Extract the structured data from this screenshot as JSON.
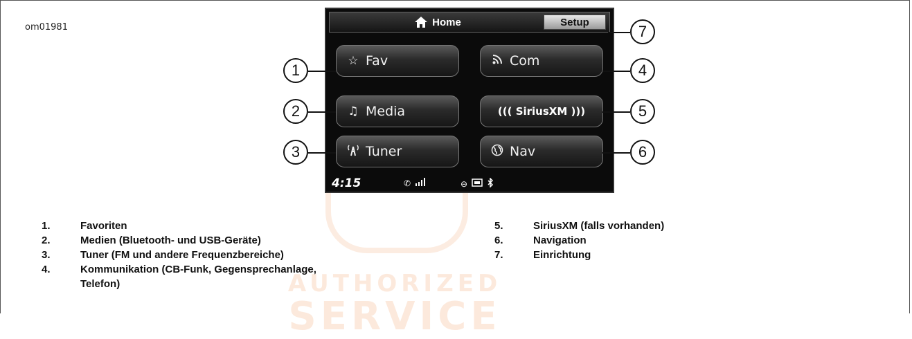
{
  "figure_id": "om01981",
  "watermark": {
    "line1": "AUTHORIZED",
    "line2": "SERVICE"
  },
  "screen": {
    "topbar": {
      "home_label": "Home",
      "setup_label": "Setup"
    },
    "buttons": [
      {
        "label": "Fav",
        "icon": "star-icon"
      },
      {
        "label": "Com",
        "icon": "rss-icon"
      },
      {
        "label": "Media",
        "icon": "music-note-icon"
      },
      {
        "label": "SiriusXM",
        "icon": "siriusxm-logo"
      },
      {
        "label": "Tuner",
        "icon": "antenna-icon"
      },
      {
        "label": "Nav",
        "icon": "globe-icon"
      }
    ],
    "status": {
      "time": "4:15"
    }
  },
  "callouts": [
    "1",
    "2",
    "3",
    "4",
    "5",
    "6",
    "7"
  ],
  "legend": {
    "left": [
      {
        "num": "1.",
        "text": "Favoriten"
      },
      {
        "num": "2.",
        "text": "Medien (Bluetooth- und USB-Geräte)"
      },
      {
        "num": "3.",
        "text": "Tuner (FM und andere Frequenzbereiche)"
      },
      {
        "num": "4.",
        "text": "Kommunikation (CB-Funk, Gegensprechanlage,"
      },
      {
        "num": "",
        "text": "Telefon)"
      }
    ],
    "right": [
      {
        "num": "5.",
        "text": "SiriusXM (falls vorhanden)"
      },
      {
        "num": "6.",
        "text": "Navigation"
      },
      {
        "num": "7.",
        "text": "Einrichtung"
      }
    ]
  }
}
